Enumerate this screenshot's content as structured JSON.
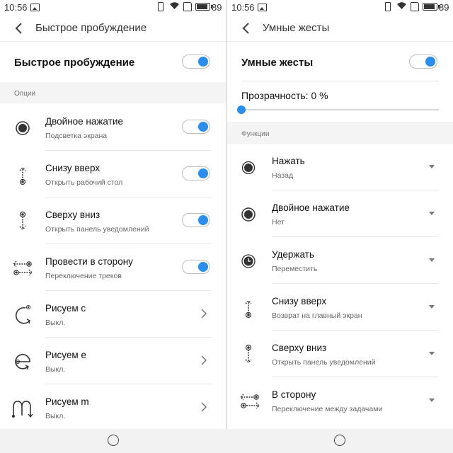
{
  "colors": {
    "accent": "#2a8ef0",
    "section_bg": "#f4f4f4",
    "nav_bg": "#f2f2f2"
  },
  "left": {
    "status": {
      "time": "10:56",
      "battery": "89"
    },
    "header": {
      "title": "Быстрое пробуждение"
    },
    "master": {
      "label": "Быстрое пробуждение",
      "enabled": true
    },
    "section": "Опции",
    "items": [
      {
        "icon": "double-tap-icon",
        "title": "Двойное нажатие",
        "subtitle": "Подсветка экрана",
        "control": "toggle",
        "enabled": true
      },
      {
        "icon": "swipe-up-icon",
        "title": "Снизу вверх",
        "subtitle": "Открыть рабочий стол",
        "control": "toggle",
        "enabled": true
      },
      {
        "icon": "swipe-down-icon",
        "title": "Сверху вниз",
        "subtitle": "Открыть панель уведомлений",
        "control": "toggle",
        "enabled": true
      },
      {
        "icon": "swipe-sideways-icon",
        "title": "Провести в сторону",
        "subtitle": "Переключение треков",
        "control": "toggle",
        "enabled": true
      },
      {
        "icon": "draw-c-icon",
        "title": "Рисуем с",
        "subtitle": "Выкл.",
        "control": "chevron"
      },
      {
        "icon": "draw-e-icon",
        "title": "Рисуем е",
        "subtitle": "Выкл.",
        "control": "chevron"
      },
      {
        "icon": "draw-m-icon",
        "title": "Рисуем m",
        "subtitle": "Выкл.",
        "control": "chevron"
      }
    ]
  },
  "right": {
    "status": {
      "time": "10:56",
      "battery": "89"
    },
    "header": {
      "title": "Умные жесты"
    },
    "master": {
      "label": "Умные жесты",
      "enabled": true
    },
    "transparency": {
      "label": "Прозрачность: 0 %",
      "value_percent": 0
    },
    "section": "Функции",
    "items": [
      {
        "icon": "tap-icon",
        "title": "Нажать",
        "subtitle": "Назад"
      },
      {
        "icon": "double-tap-icon",
        "title": "Двойное нажатие",
        "subtitle": "Нет"
      },
      {
        "icon": "long-press-icon",
        "title": "Удержать",
        "subtitle": "Переместить"
      },
      {
        "icon": "swipe-up-icon",
        "title": "Снизу вверх",
        "subtitle": "Возврат на главный экран"
      },
      {
        "icon": "swipe-down-icon",
        "title": "Сверху вниз",
        "subtitle": "Открыть панель уведомлений"
      },
      {
        "icon": "swipe-sideways-icon",
        "title": "В сторону",
        "subtitle": "Переключение между задачами"
      }
    ]
  }
}
